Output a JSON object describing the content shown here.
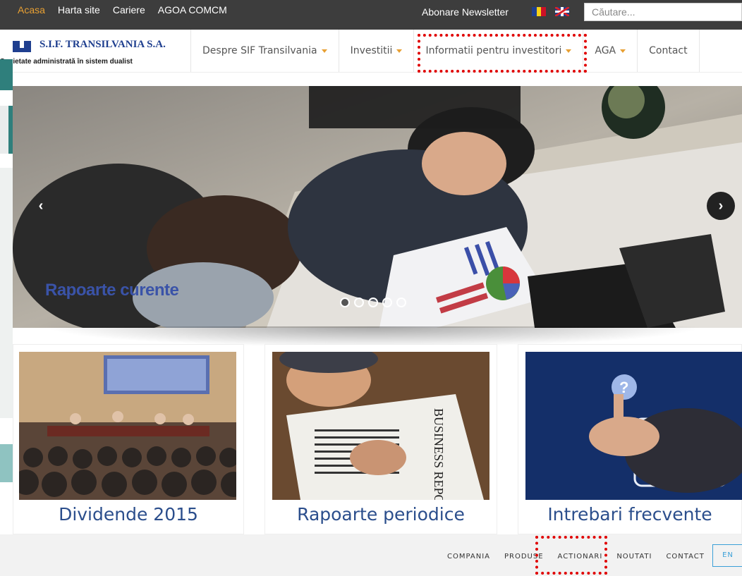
{
  "topbar": {
    "links": [
      "Acasa",
      "Harta site",
      "Cariere",
      "AGOA COMCM"
    ],
    "newsletter": "Abonare Newsletter",
    "search_placeholder": "Căutare..."
  },
  "logo": {
    "name": "S.I.F. TRANSILVANIA S.A.",
    "subtitle": "Societate administrată în sistem dualist"
  },
  "nav": {
    "items": [
      {
        "label": "Despre SIF Transilvania",
        "dropdown": true
      },
      {
        "label": "Investitii",
        "dropdown": true
      },
      {
        "label": "Informatii pentru investitori",
        "dropdown": true
      },
      {
        "label": "AGA",
        "dropdown": true
      },
      {
        "label": "Contact",
        "dropdown": false
      }
    ]
  },
  "slider": {
    "caption": "Rapoarte curente",
    "slide_count": 5,
    "active_slide": 1
  },
  "cards": [
    {
      "label": "Dividende 2015",
      "image": "conference-audience"
    },
    {
      "label": "Rapoarte  periodice",
      "image": "business-report-newspaper"
    },
    {
      "label": "Intrebari frecvente",
      "image": "touch-question-mark"
    }
  ],
  "footer": {
    "links": [
      "COMPANIA",
      "PRODUSE",
      "ACTIONARI",
      "NOUTATI",
      "CONTACT"
    ],
    "lang_button": "EN"
  },
  "colors": {
    "accent": "#e8a033",
    "brand": "#1f3f8f",
    "highlight": "#e00000",
    "card_text": "#2b4e8c"
  }
}
